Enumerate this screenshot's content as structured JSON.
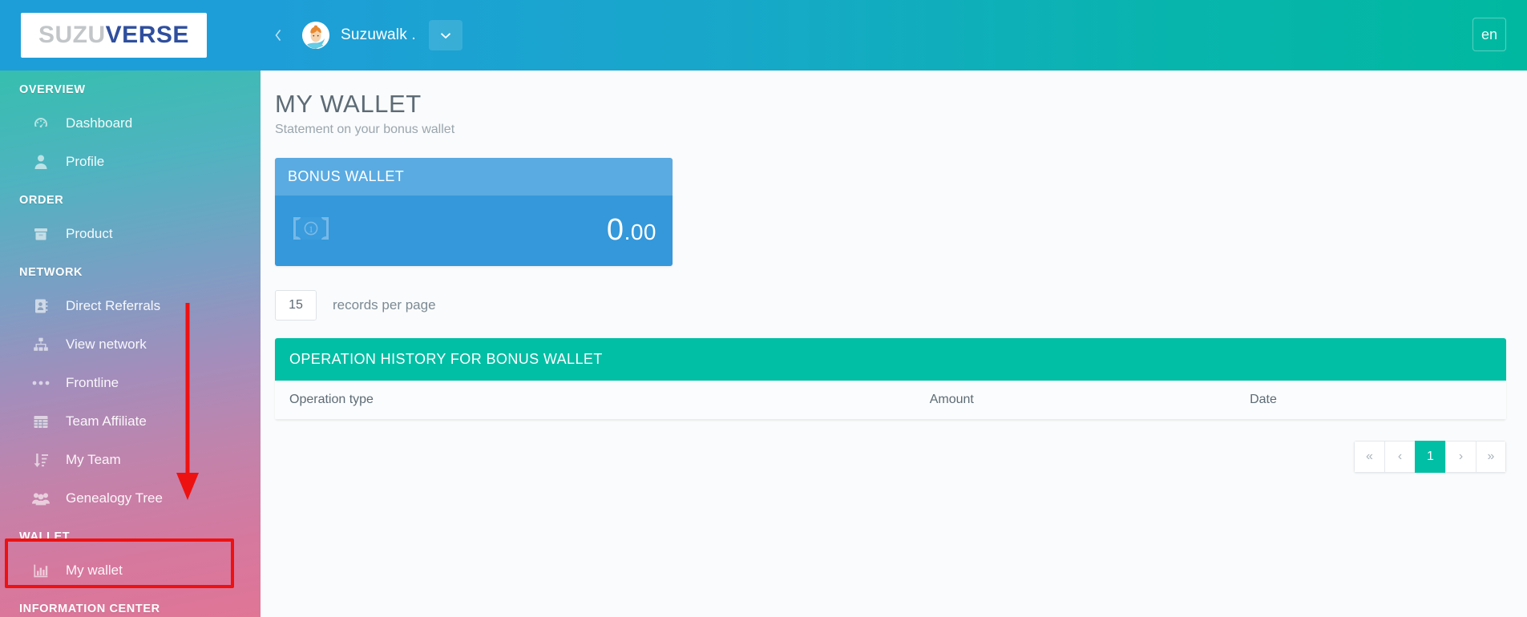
{
  "brand": {
    "logo_part1": "SUZU",
    "logo_part2": "VERSE"
  },
  "header": {
    "collapse_icon": "chevron-left-icon",
    "user_name": "Suzuwalk .",
    "caret_icon": "chevron-down-icon",
    "language": "en"
  },
  "sidebar": {
    "sections": [
      {
        "label": "OVERVIEW",
        "items": [
          {
            "label": "Dashboard",
            "icon": "dashboard-icon"
          },
          {
            "label": "Profile",
            "icon": "user-icon"
          }
        ]
      },
      {
        "label": "ORDER",
        "items": [
          {
            "label": "Product",
            "icon": "box-icon"
          }
        ]
      },
      {
        "label": "NETWORK",
        "items": [
          {
            "label": "Direct Referrals",
            "icon": "contact-book-icon"
          },
          {
            "label": "View network",
            "icon": "sitemap-icon"
          },
          {
            "label": "Frontline",
            "icon": "ellipsis-icon"
          },
          {
            "label": "Team Affiliate",
            "icon": "grid-table-icon"
          },
          {
            "label": "My Team",
            "icon": "sort-amount-icon"
          },
          {
            "label": "Genealogy Tree",
            "icon": "users-group-icon"
          }
        ]
      },
      {
        "label": "WALLET",
        "items": [
          {
            "label": "My wallet",
            "icon": "bar-chart-icon"
          }
        ]
      },
      {
        "label": "INFORMATION CENTER",
        "items": []
      }
    ]
  },
  "page": {
    "title": "MY WALLET",
    "subtitle": "Statement on your bonus wallet"
  },
  "wallet_card": {
    "title": "BONUS WALLET",
    "icon": "money-bill-icon",
    "amount_int": "0",
    "amount_dec": ".00"
  },
  "per_page": {
    "value": "15",
    "placeholder": "15",
    "label": "records per page"
  },
  "history_panel": {
    "title": "OPERATION HISTORY FOR BONUS WALLET",
    "columns": [
      "Operation type",
      "Amount",
      "Date"
    ],
    "rows": []
  },
  "pagination": {
    "first": "«",
    "prev": "‹",
    "pages": [
      "1"
    ],
    "next": "›",
    "last": "»",
    "active": "1"
  },
  "annotations": {
    "highlight_target": "My wallet",
    "arrow_color": "#ee1111",
    "rect_color": "#ee1111"
  },
  "colors": {
    "brand_blue": "#1e9ed8",
    "teal": "#00bfa5",
    "card_blue": "#3498db",
    "card_header_blue": "#5aabe2"
  }
}
